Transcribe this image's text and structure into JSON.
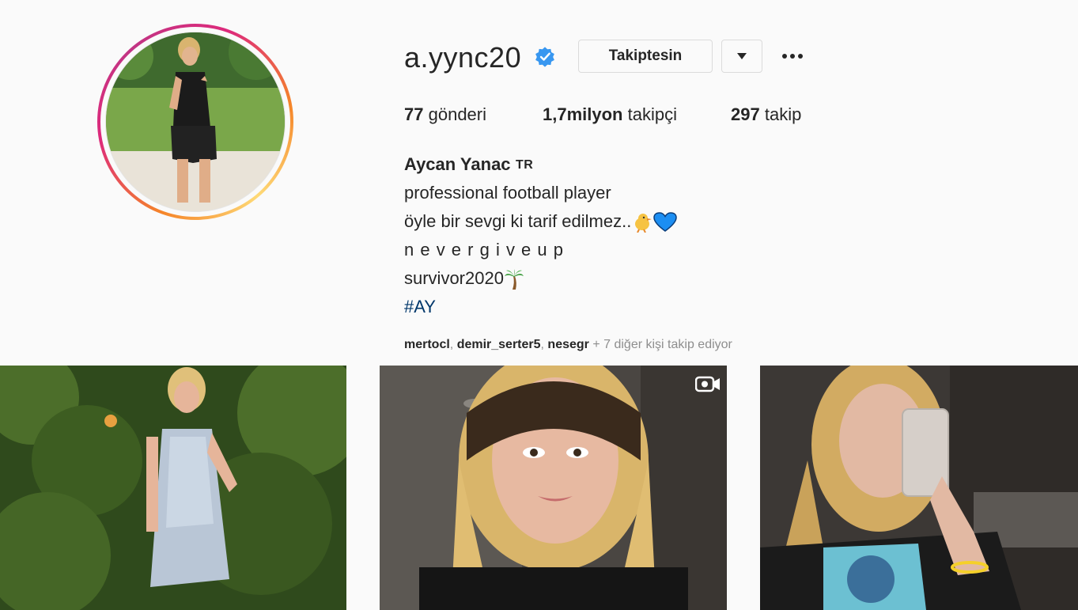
{
  "profile": {
    "username": "a.yync20",
    "verified": true,
    "follow_label": "Takiptesin",
    "stats": {
      "posts_count": "77",
      "posts_label": "gönderi",
      "followers_count": "1,7milyon",
      "followers_label": "takipçi",
      "following_count": "297",
      "following_label": "takip"
    },
    "bio": {
      "name": "Aycan Yanac",
      "category": "TR",
      "line1": "professional football player",
      "line2": "öyle bir sevgi ki tarif edilmez..",
      "line3": "n e v e r g i v e u p",
      "line4": "survivor2020",
      "hashtag": "#AY"
    },
    "followed_by": {
      "user1": "mertocl",
      "user2": "demir_serter5",
      "user3": "nesegr",
      "rest": "+ 7 diğer kişi takip ediyor"
    }
  },
  "icons": {
    "verified": "verified-badge-icon",
    "dropdown": "caret-down-icon",
    "more": "ellipsis-icon",
    "reel": "igtv-icon"
  },
  "colors": {
    "background": "#fafafa",
    "text": "#262626",
    "secondary": "#8e8e8e",
    "verified": "#3897f0",
    "hashtag": "#00376b",
    "border": "#dbdbdb"
  }
}
